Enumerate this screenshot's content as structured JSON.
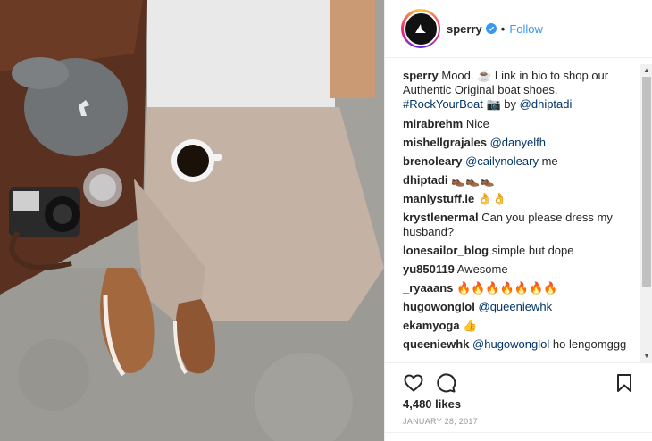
{
  "header": {
    "username": "sperry",
    "dot": "•",
    "follow_label": "Follow"
  },
  "caption": {
    "username": "sperry",
    "text": "Mood. ☕ Link in bio to shop our Authentic Original boat shoes.",
    "hashtag": "#RockYourBoat",
    "camera": "📷",
    "by": "by",
    "credit": "@dhiptadi"
  },
  "comments": [
    {
      "user": "mirabrehm",
      "text": "Nice",
      "mention": ""
    },
    {
      "user": "mishellgrajales",
      "text": "",
      "mention": "@danyelfh"
    },
    {
      "user": "brenoleary",
      "text": "me",
      "mention": "@cailynoleary"
    },
    {
      "user": "dhiptadi",
      "text": "👞👞👞",
      "mention": ""
    },
    {
      "user": "manlystuff.ie",
      "text": "👌👌",
      "mention": ""
    },
    {
      "user": "krystlenermal",
      "text": "Can you please dress my husband?",
      "mention": ""
    },
    {
      "user": "lonesailor_blog",
      "text": "simple but dope",
      "mention": ""
    },
    {
      "user": "yu850119",
      "text": "Awesome",
      "mention": ""
    },
    {
      "user": "_ryaaans",
      "text": "🔥🔥🔥🔥🔥🔥🔥",
      "mention": ""
    },
    {
      "user": "hugowonglol",
      "text": "",
      "mention": "@queeniewhk"
    },
    {
      "user": "ekamyoga",
      "text": "👍",
      "mention": ""
    },
    {
      "user": "queeniewhk",
      "text": "ho lengomggg",
      "mention": "@hugowonglol"
    }
  ],
  "scrollbar": {
    "up": "▲",
    "down": "▼"
  },
  "likes": "4,480 likes",
  "date": "JANUARY 28, 2017",
  "icons": {
    "heart": "heart-icon",
    "comment": "comment-bubble-icon",
    "save": "bookmark-icon",
    "verified": "verified-badge-icon"
  },
  "colors": {
    "follow": "#3897f0",
    "verified": "#3897f0",
    "mention": "#003569",
    "date": "#999999"
  }
}
